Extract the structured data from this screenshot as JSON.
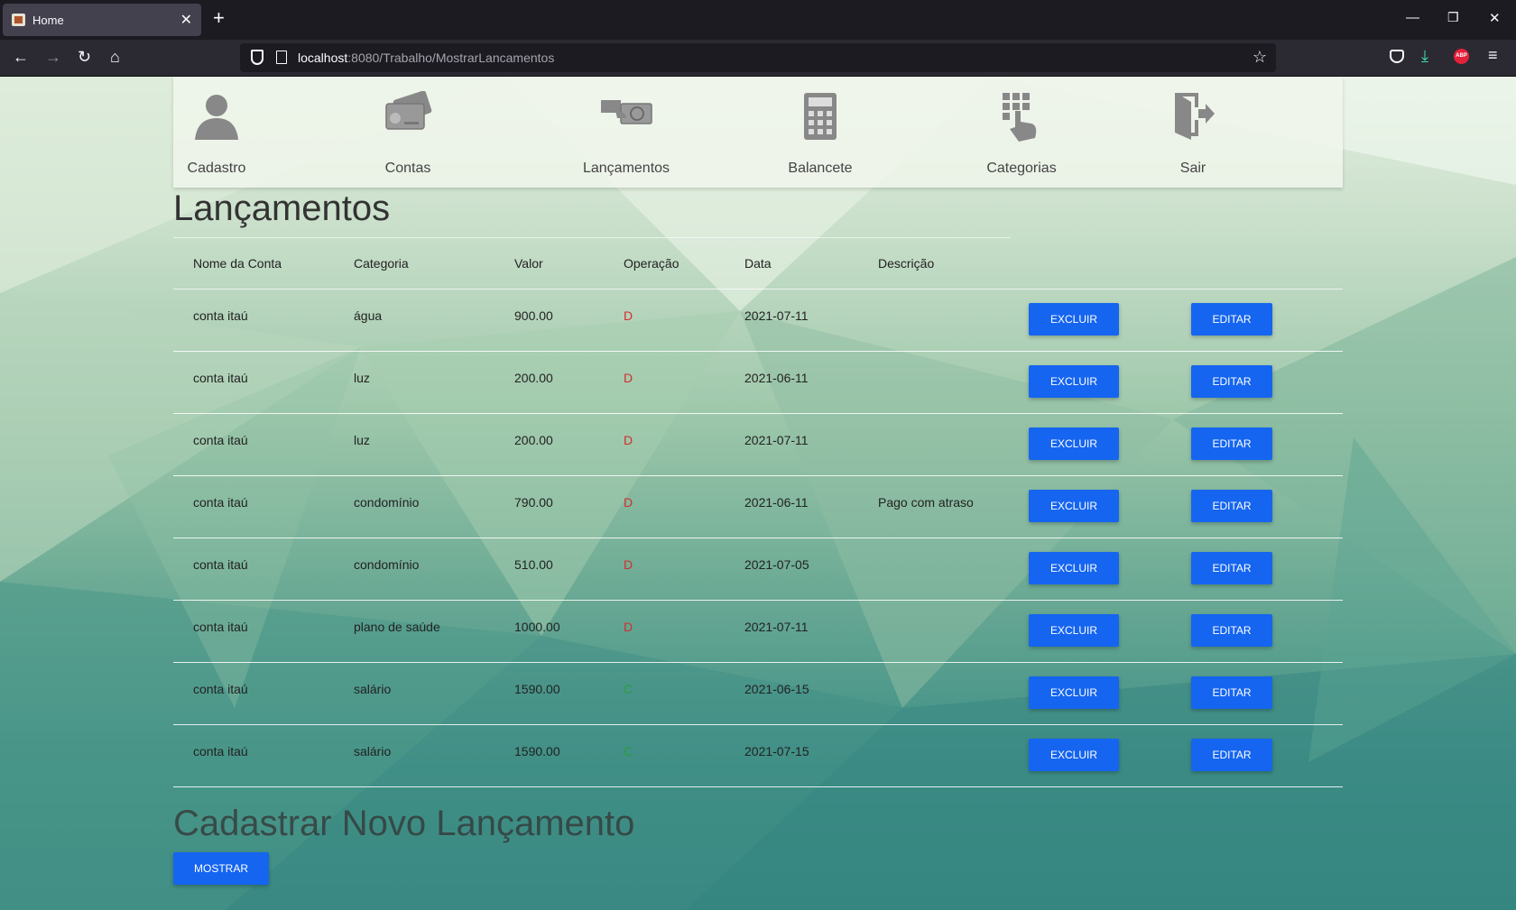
{
  "browser": {
    "tab_title": "Home",
    "url_host": "localhost",
    "url_rest": ":8080/Trabalho/MostrarLancamentos",
    "abp_label": "ABP"
  },
  "nav": {
    "items": [
      {
        "label": "Cadastro",
        "icon": "user-icon"
      },
      {
        "label": "Contas",
        "icon": "credit-card-icon"
      },
      {
        "label": "Lançamentos",
        "icon": "payment-hand-icon"
      },
      {
        "label": "Balancete",
        "icon": "calculator-icon"
      },
      {
        "label": "Categorias",
        "icon": "grid-pointer-icon"
      },
      {
        "label": "Sair",
        "icon": "exit-door-icon"
      }
    ]
  },
  "main": {
    "title": "Lançamentos",
    "columns": [
      "Nome da Conta",
      "Categoria",
      "Valor",
      "Operação",
      "Data",
      "Descrição"
    ],
    "rows": [
      {
        "conta": "conta itaú",
        "categoria": "água",
        "valor": "900.00",
        "operacao": "D",
        "data": "2021-07-11",
        "descricao": ""
      },
      {
        "conta": "conta itaú",
        "categoria": "luz",
        "valor": "200.00",
        "operacao": "D",
        "data": "2021-06-11",
        "descricao": ""
      },
      {
        "conta": "conta itaú",
        "categoria": "luz",
        "valor": "200.00",
        "operacao": "D",
        "data": "2021-07-11",
        "descricao": ""
      },
      {
        "conta": "conta itaú",
        "categoria": "condomínio",
        "valor": "790.00",
        "operacao": "D",
        "data": "2021-06-11",
        "descricao": "Pago com atraso"
      },
      {
        "conta": "conta itaú",
        "categoria": "condomínio",
        "valor": "510.00",
        "operacao": "D",
        "data": "2021-07-05",
        "descricao": ""
      },
      {
        "conta": "conta itaú",
        "categoria": "plano de saúde",
        "valor": "1000.00",
        "operacao": "D",
        "data": "2021-07-11",
        "descricao": ""
      },
      {
        "conta": "conta itaú",
        "categoria": "salário",
        "valor": "1590.00",
        "operacao": "C",
        "data": "2021-06-15",
        "descricao": ""
      },
      {
        "conta": "conta itaú",
        "categoria": "salário",
        "valor": "1590.00",
        "operacao": "C",
        "data": "2021-07-15",
        "descricao": ""
      }
    ],
    "excluir_label": "EXCLUIR",
    "editar_label": "EDITAR"
  },
  "novo": {
    "title": "Cadastrar Novo Lançamento",
    "mostrar_label": "MOSTRAR"
  },
  "colors": {
    "button": "#1565f0",
    "debit": "#d32f2f",
    "credit": "#2e9d3c"
  }
}
